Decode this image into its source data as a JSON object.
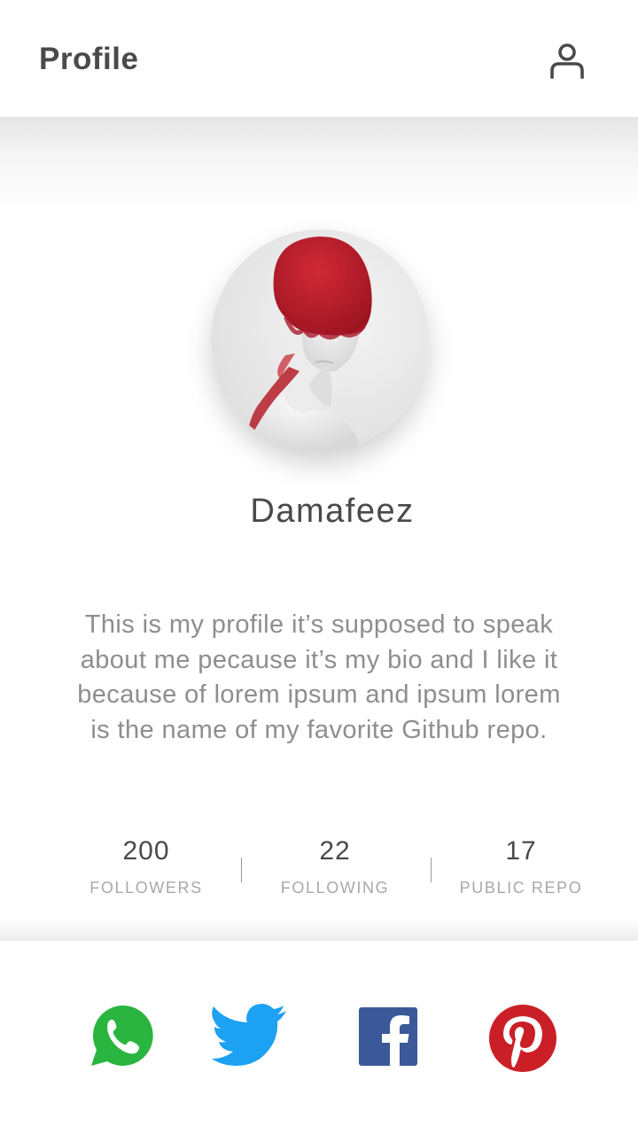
{
  "header": {
    "title": "Profile",
    "profile_icon": "user-icon"
  },
  "profile": {
    "avatar": "avatar-photo",
    "name": "Damafeez",
    "bio": "This is my profile it’s supposed to speak about me pecause it’s my bio and I like it because of lorem ipsum and ipsum lorem is the name of my favorite Github repo."
  },
  "stats": [
    {
      "value": "200",
      "label": "FOLLOWERS"
    },
    {
      "value": "22",
      "label": "FOLLOWING"
    },
    {
      "value": "17",
      "label": "PUBLIC REPO"
    }
  ],
  "social": [
    {
      "name": "whatsapp",
      "icon": "whatsapp-icon",
      "color": "#2AB540"
    },
    {
      "name": "twitter",
      "icon": "twitter-icon",
      "color": "#1DA1F2"
    },
    {
      "name": "facebook",
      "icon": "facebook-icon",
      "color": "#3B5998"
    },
    {
      "name": "pinterest",
      "icon": "pinterest-icon",
      "color": "#CB1F27"
    }
  ],
  "colors": {
    "text_primary": "#4A4A4A",
    "text_secondary": "#8E8E8E",
    "label": "#A8A8A8",
    "background": "#FFFFFF"
  }
}
